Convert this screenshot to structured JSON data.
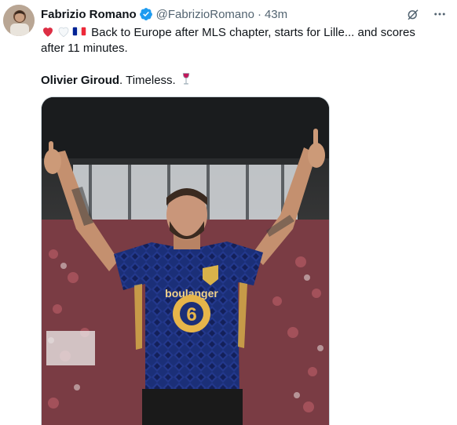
{
  "author": {
    "display_name": "Fabrizio Romano",
    "handle": "@FabrizioRomano",
    "separator": "·",
    "timestamp": "43m",
    "avatar_icon": "profile-photo",
    "verified_icon": "verified-badge-icon"
  },
  "actions": {
    "grok_icon": "grok-icon",
    "more_icon": "more-options-icon"
  },
  "tweet": {
    "line1_emojis": [
      "red-heart",
      "white-heart",
      "france-flag"
    ],
    "line1_text": "Back to Europe after MLS chapter, starts for Lille... and scores",
    "line2_text": "after 11 minutes.",
    "line3_bold": "Olivier Giroud",
    "line3_text": ". Timeless. ",
    "line3_emoji": "wine-glass"
  },
  "media": {
    "kit_sponsor": "boulanger",
    "kit_number": "6"
  },
  "colors": {
    "verified": "#1d9bf0",
    "text": "#0f1419",
    "secondary": "#536471",
    "kit": "#1b2f78"
  }
}
